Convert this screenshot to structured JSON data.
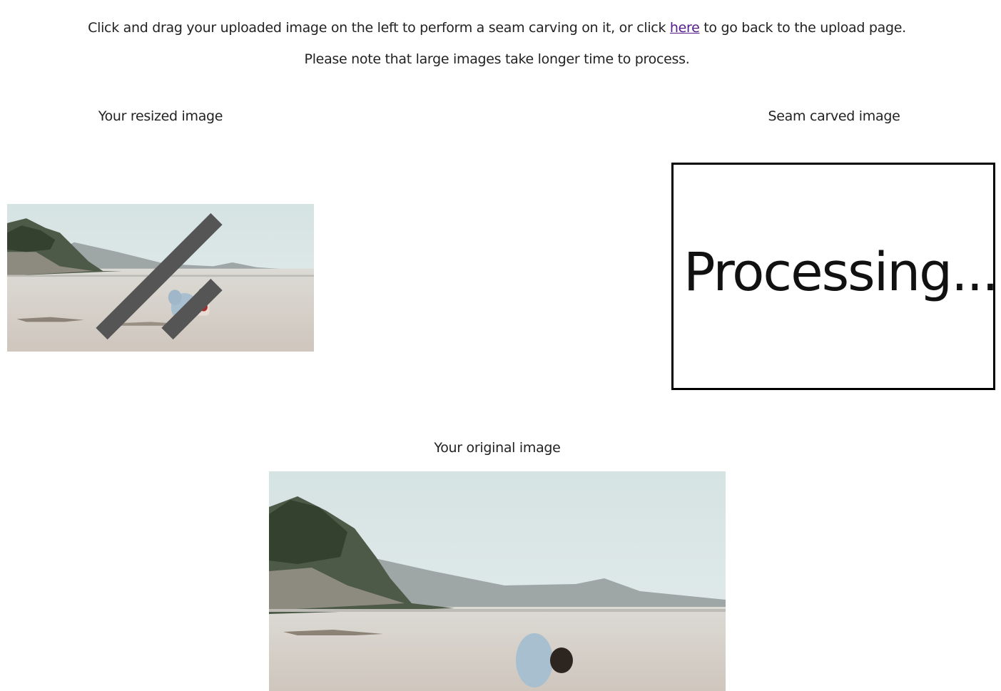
{
  "instructions": {
    "line1_before": "Click and drag your uploaded image on the left to perform a seam carving on it, or click ",
    "line1_link": "here",
    "line1_after": " to go back to the upload page.",
    "line2": "Please note that large images take longer time to process."
  },
  "resized": {
    "caption": "Your resized image"
  },
  "carved": {
    "caption": "Seam carved image",
    "status": "Processing..."
  },
  "original": {
    "caption": "Your original image"
  },
  "colors": {
    "link": "#551a8b",
    "text": "#222222",
    "frame": "#000000"
  }
}
